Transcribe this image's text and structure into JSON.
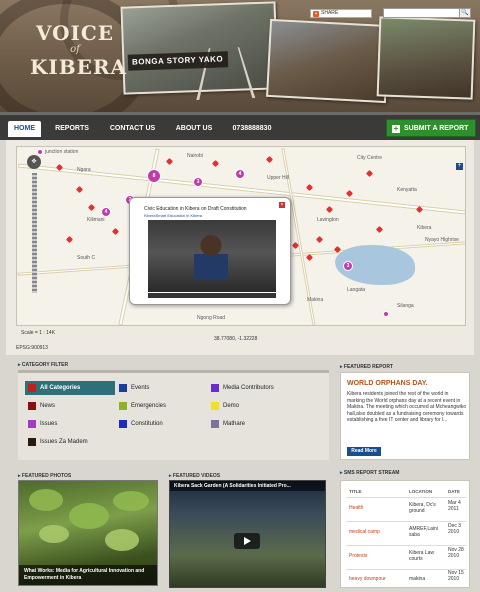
{
  "header": {
    "logo_line1": "VOICE",
    "logo_line2": "of",
    "logo_line3": "KIBERA",
    "tagline": "BONGA STORY YAKO",
    "share_label": "SHARE"
  },
  "nav": {
    "items": [
      {
        "label": "HOME"
      },
      {
        "label": "REPORTS"
      },
      {
        "label": "CONTACT US"
      },
      {
        "label": "ABOUT US"
      },
      {
        "label": "0738888830"
      }
    ],
    "submit_label": "SUBMIT A REPORT"
  },
  "map": {
    "labels": [
      "junction station",
      "Nairobi",
      "Ngara",
      "City Centre",
      "Upper Hill",
      "Kenyatta",
      "Kilimani",
      "Lavington",
      "Kibera",
      "South C",
      "Nyayo Highrise",
      "Langata",
      "Makina",
      "Silanga",
      "Ngong Road"
    ],
    "popup_title": "Civic Education in Kibera on Draft Constitution",
    "popup_sub": "KiberaSmart  Education in Kibera",
    "scale": "Scale = 1 : 14K",
    "coords": "38.77080, -1.32228",
    "epsg": "EPSG:900913"
  },
  "category_filter": {
    "title": "CATEGORY FILTER",
    "items": [
      {
        "label": "All Categories",
        "color": "#c0201a"
      },
      {
        "label": "Events",
        "color": "#1a3da0"
      },
      {
        "label": "Media Contributors",
        "color": "#6a2bd0"
      },
      {
        "label": "News",
        "color": "#8a1010"
      },
      {
        "label": "Emergencies",
        "color": "#8fb320"
      },
      {
        "label": "Demo",
        "color": "#f0e020"
      },
      {
        "label": "Issues",
        "color": "#a03cc0"
      },
      {
        "label": "Constitution",
        "color": "#1a2bc0"
      },
      {
        "label": "Mathare",
        "color": "#8070a0"
      },
      {
        "label": "Issues Za Madem",
        "color": "#2a1a10"
      }
    ]
  },
  "featured_report": {
    "title": "FEATURED REPORT",
    "headline": "WORLD ORPHANS DAY.",
    "body": "Kibera residents joined the rest of the world in marking the World orphans day at a recent event in Makina. The meeting which occurred at Mcheangwiko hall,also doubled as a fundraising ceremony towards establishing a free IT center and library for l...",
    "button": "Read More"
  },
  "featured_photos": {
    "title": "FEATURED PHOTOS",
    "caption": "What Works: Media for Agricultural Innovation and Empowerment in Kibera"
  },
  "featured_videos": {
    "title": "FEATURED VIDEOS",
    "video_title": "Kibera Sack Garden (A Solidarities Initiated Pro..."
  },
  "sms": {
    "title": "SMS REPORT STREAM",
    "headers": [
      "TITLE",
      "LOCATION",
      "DATE"
    ],
    "rows": [
      {
        "title": "Health",
        "location": "Kibera, Dc's ground",
        "date": "Mar 4 2011"
      },
      {
        "title": "medical camp",
        "location": "AMREF,Laini saba",
        "date": "Dec 3 2010"
      },
      {
        "title": "Protests",
        "location": "Kibera Law courts",
        "date": "Nov 28 2010"
      },
      {
        "title": "heavy downpour",
        "location": "makina",
        "date": "Nov 15 2010"
      }
    ]
  }
}
